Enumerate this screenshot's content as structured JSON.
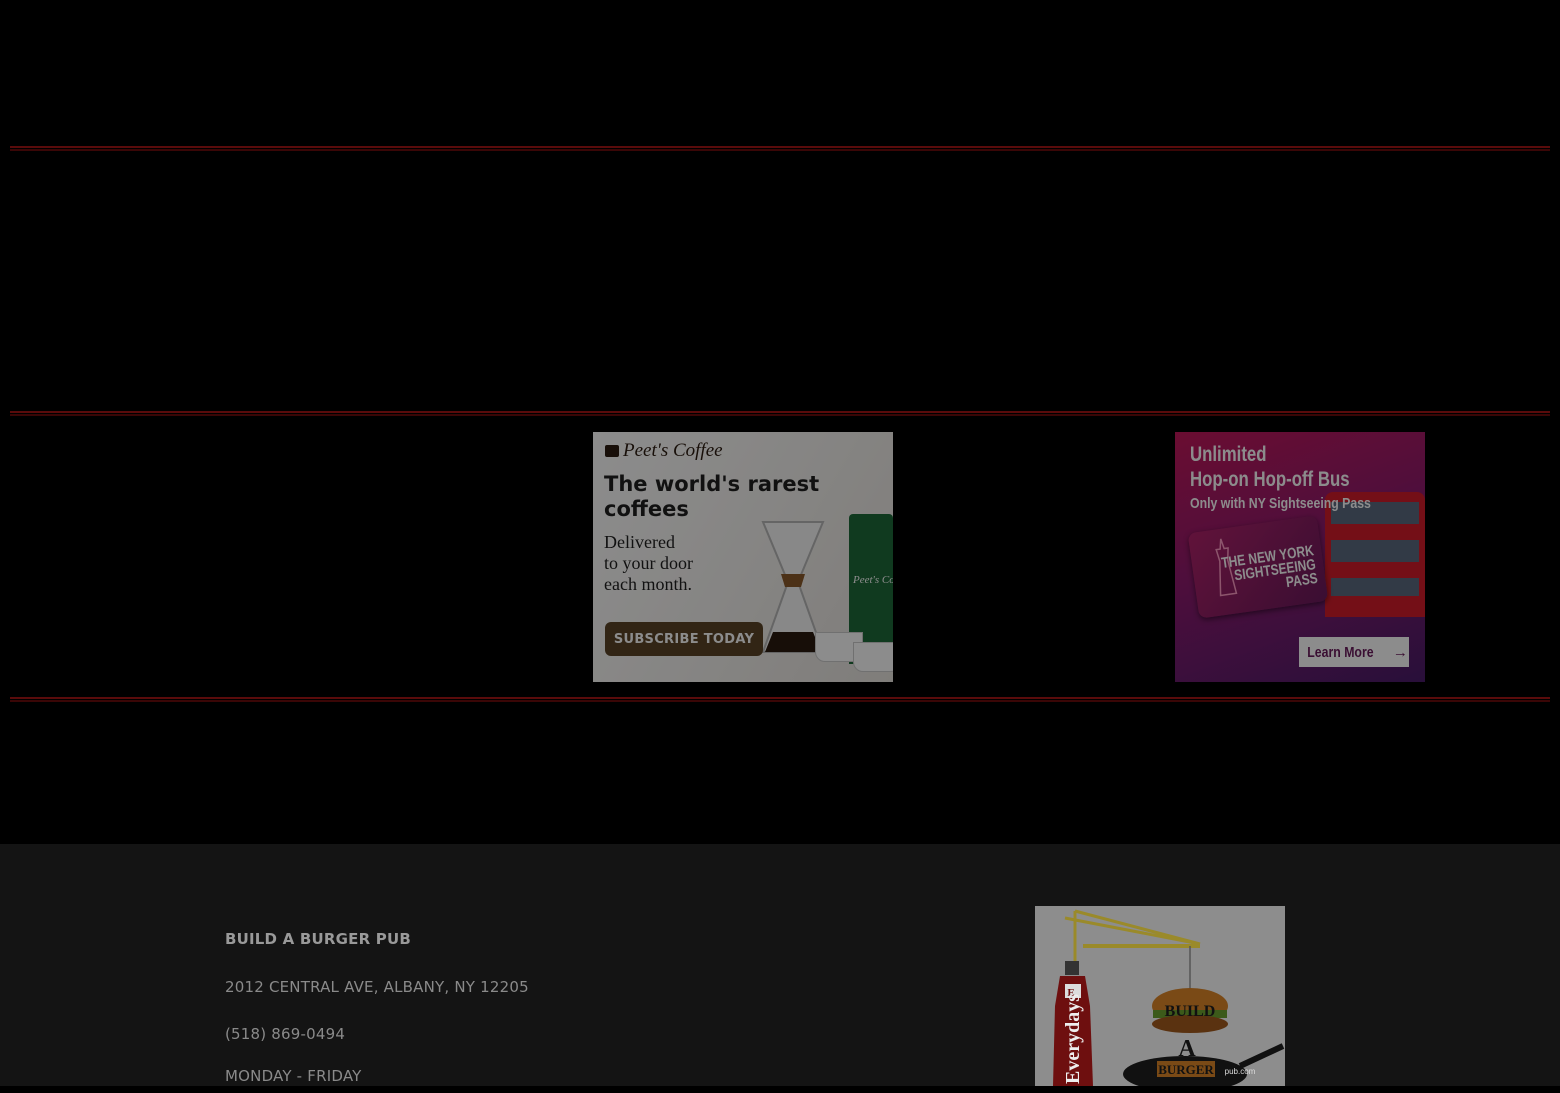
{
  "ads": {
    "peets": {
      "brand": "Peet's Coffee",
      "headline": "The world's rarest\ncoffees",
      "subline": "Delivered\nto your door\neach month.",
      "cta": "SUBSCRIBE TODAY",
      "bag_text": "Peet's Co"
    },
    "sightseeing": {
      "title": "Unlimited\nHop-on Hop-off Bus",
      "subtitle": "Only with NY Sightseeing Pass",
      "card_text": "THE NEW YORK\nSIGHTSEEING\nPASS",
      "cta": "Learn More"
    }
  },
  "footer": {
    "name": "BUILD A BURGER PUB",
    "address": "2012 CENTRAL AVE, ALBANY, NY 12205",
    "phone": "(518) 869-0494",
    "hours_label": "MONDAY - FRIDAY",
    "logo": {
      "ketchup_text": "Everydays",
      "burger_word": "BUILD",
      "letter": "A",
      "pan_word": "BURGER",
      "suffix": "pub.com"
    }
  },
  "colors": {
    "background": "#000000",
    "divider": "#5a0b0b",
    "footer_bg": "#141414",
    "footer_text": "#8a8a8a"
  }
}
